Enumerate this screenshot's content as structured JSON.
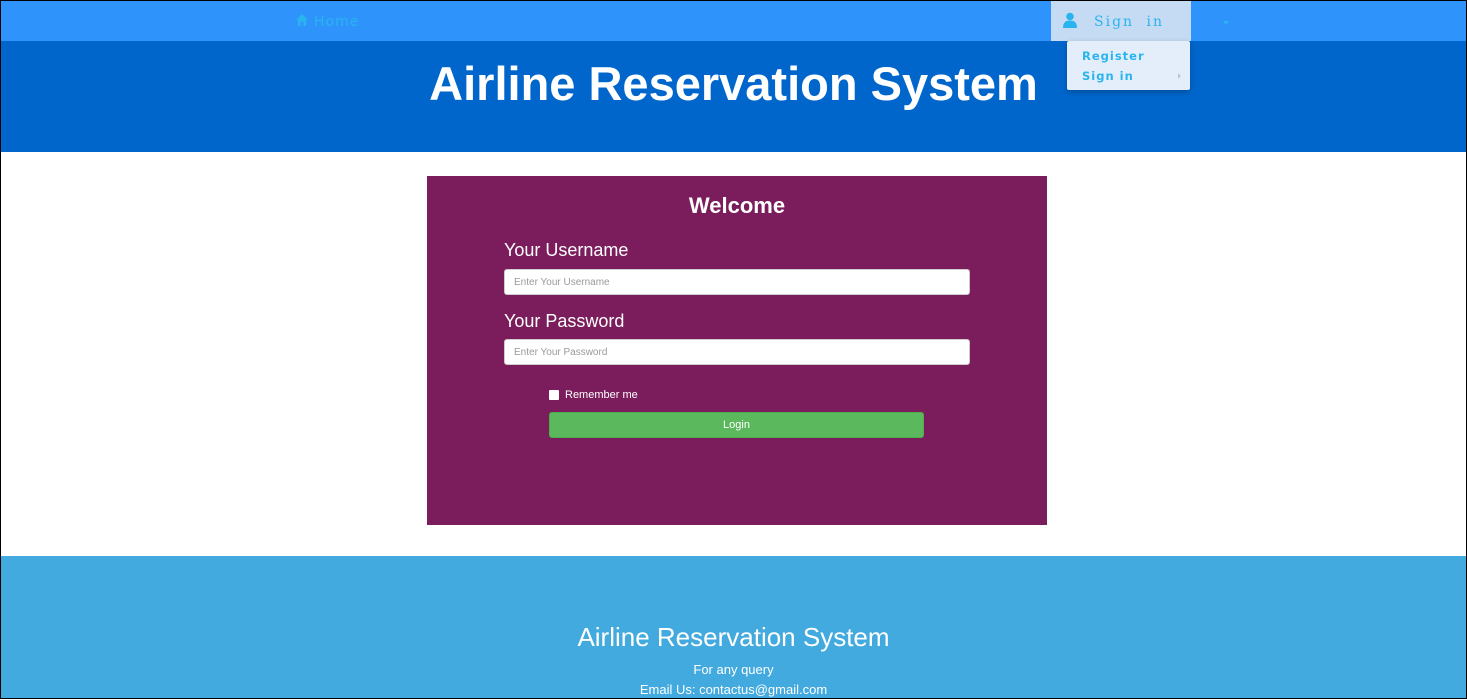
{
  "navbar": {
    "home_label": "Home",
    "home_icon": "home-icon",
    "signin_label": "Sign in",
    "signin_icon": "user-icon",
    "colors": {
      "bar": "#2e93fa",
      "link": "#29b4f0"
    }
  },
  "dropdown": {
    "items": [
      {
        "label": "Register"
      },
      {
        "label": "Sign in"
      }
    ]
  },
  "header": {
    "title": "Airline Reservation System",
    "color": "#0066cc"
  },
  "login": {
    "heading": "Welcome",
    "username_label": "Your Username",
    "username_placeholder": "Enter Your Username",
    "username_value": "",
    "password_label": "Your Password",
    "password_placeholder": "Enter Your Password",
    "password_value": "",
    "remember_label": "Remember me",
    "remember_checked": false,
    "login_label": "Login",
    "colors": {
      "card": "#7b1d5c",
      "button": "#5cb85c"
    }
  },
  "footer": {
    "title": "Airline Reservation System",
    "line1": "For any query",
    "line2": "Email Us: contactus@gmail.com",
    "color": "#42aade"
  }
}
